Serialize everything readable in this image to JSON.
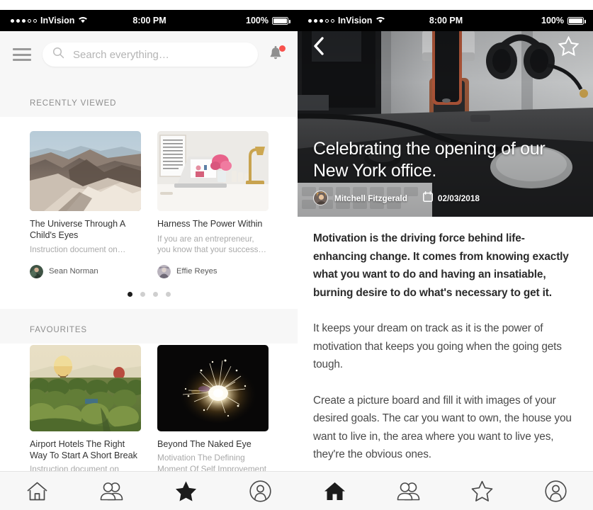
{
  "status_bar": {
    "carrier": "InVision",
    "signal_filled": 3,
    "signal_hollow": 2,
    "time": "8:00 PM",
    "battery": "100%"
  },
  "left_screen": {
    "header": {
      "menu_icon": "hamburger-icon",
      "search_placeholder": "Search everything…",
      "search_value": "",
      "search_icon": "search-icon",
      "bell_icon": "bell-icon",
      "bell_badge_color": "#f8524d"
    },
    "sections": [
      {
        "label": "RECENTLY VIEWED"
      },
      {
        "label": "FAVOURITES"
      }
    ],
    "recently_viewed": {
      "label": "RECENTLY VIEWED",
      "cards": [
        {
          "thumb": "desert-mountains-photo",
          "title": "The Universe Through A Child's Eyes",
          "desc": "Instruction document on…",
          "author": "Sean Norman",
          "avatar": "avatar-sean-norman"
        },
        {
          "thumb": "white-desk-workspace-photo",
          "title": "Harness The Power Within",
          "desc": "If you are an entrepreneur, you know that your success…",
          "author": "Effie Reyes",
          "avatar": "avatar-effie-reyes"
        }
      ],
      "pager": {
        "total": 4,
        "active": 1
      }
    },
    "favourites": {
      "label": "FAVOURITES",
      "cards": [
        {
          "thumb": "hot-air-balloons-photo",
          "title": "Airport Hotels The Right Way To Start A Short Break",
          "desc": "Instruction document on"
        },
        {
          "thumb": "sparkler-firework-photo",
          "title": "Beyond The Naked Eye",
          "desc": "Motivation The Defining Moment Of Self Improvement"
        }
      ]
    },
    "tabbar": [
      {
        "name": "home",
        "icon": "home-icon",
        "active": false
      },
      {
        "name": "people",
        "icon": "people-icon",
        "active": false
      },
      {
        "name": "favourites",
        "icon": "star-icon",
        "active": true
      },
      {
        "name": "profile",
        "icon": "profile-icon",
        "active": false
      }
    ]
  },
  "right_screen": {
    "nav": {
      "back_icon": "chevron-left-icon",
      "star_icon": "star-outline-icon"
    },
    "hero": {
      "image": "desk-phone-headphones-photo",
      "title": "Celebrating the opening of our New York office.",
      "author": "Mitchell Fitzgerald",
      "avatar": "avatar-mitchell-fitzgerald",
      "date_icon": "calendar-icon",
      "date": "02/03/2018"
    },
    "article": {
      "lead": "Motivation is the driving force behind life-enhancing change. It comes from knowing exactly what you want to do and having an insatiable, burning desire to do what's necessary to get it.",
      "paragraphs": [
        "It keeps your dream on track as it is the power of motivation that keeps you going when the going gets tough.",
        "Create a picture board and fill it with images of your desired goals. The car you want to own, the house you want to live in, the area where you want to live yes, they're the obvious ones."
      ]
    },
    "tabbar": [
      {
        "name": "home",
        "icon": "home-icon",
        "active": true
      },
      {
        "name": "people",
        "icon": "people-icon",
        "active": false
      },
      {
        "name": "favourites",
        "icon": "star-icon",
        "active": false
      },
      {
        "name": "profile",
        "icon": "profile-icon",
        "active": false
      }
    ]
  }
}
